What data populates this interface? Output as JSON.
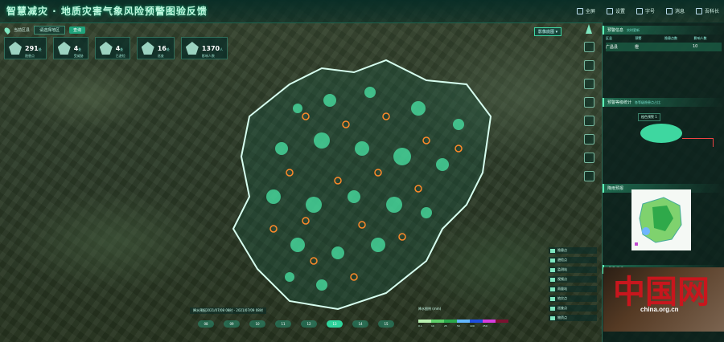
{
  "header": {
    "title": "智慧减灾 · 地质灾害气象风险预警图验反馈",
    "nav": [
      {
        "label": "全屏"
      },
      {
        "label": "设置"
      },
      {
        "label": "字号"
      },
      {
        "label": "消息"
      },
      {
        "label": "吾科长"
      }
    ]
  },
  "filters": {
    "region_label": "当前区县",
    "region_value": "",
    "select_placeholder": "请选择地区",
    "query_button": "查询"
  },
  "stats": [
    {
      "value": "291",
      "unit": "处",
      "label": "隐患点"
    },
    {
      "value": "4",
      "unit": "处",
      "label": "受威胁"
    },
    {
      "value": "4",
      "unit": "处",
      "label": "已避险"
    },
    {
      "value": "16",
      "unit": "处",
      "label": "巡查"
    },
    {
      "value": "1370",
      "unit": "人",
      "label": "影响人数"
    }
  ],
  "map": {
    "layer_tag": "影像底图 ▾"
  },
  "right_panel": {
    "section1": {
      "title": "预警信息",
      "subtitle": "实时更新",
      "headers": [
        "区县",
        "预警",
        "隐患点数",
        "影响人数"
      ],
      "highlight_row": [
        "广昌县",
        "橙",
        "",
        "10"
      ]
    },
    "section2": {
      "title": "预警等级统计",
      "subtitle": "各等级隐患点占比",
      "pie_label": "橙色预警 1"
    },
    "section3": {
      "title": "降雨预报"
    },
    "section4": {
      "title": "现场反馈"
    }
  },
  "legend_list": [
    {
      "label": "隐患点"
    },
    {
      "label": "避险点"
    },
    {
      "label": "监测站"
    },
    {
      "label": "视频点"
    },
    {
      "label": "雨量站"
    },
    {
      "label": "地灾点"
    },
    {
      "label": "巡查点"
    },
    {
      "label": "物资点"
    }
  ],
  "timeline": {
    "label": "降水预报2021/07/08 08时 - 2021/07/09 08时",
    "days": [
      "08",
      "09",
      "10",
      "11",
      "12",
      "13",
      "14",
      "15"
    ]
  },
  "rain_legend": {
    "label": "降水图例 (mm)",
    "colors": [
      "#b8f0b0",
      "#5fd06a",
      "#2aa84a",
      "#63b7ff",
      "#1e4fe0",
      "#d83ce0",
      "#7a1230"
    ],
    "ticks": [
      "0.1",
      "10",
      "25",
      "50",
      "100",
      "250",
      ""
    ]
  },
  "watermark": {
    "big": "中国网",
    "url": "china.org.cn"
  }
}
